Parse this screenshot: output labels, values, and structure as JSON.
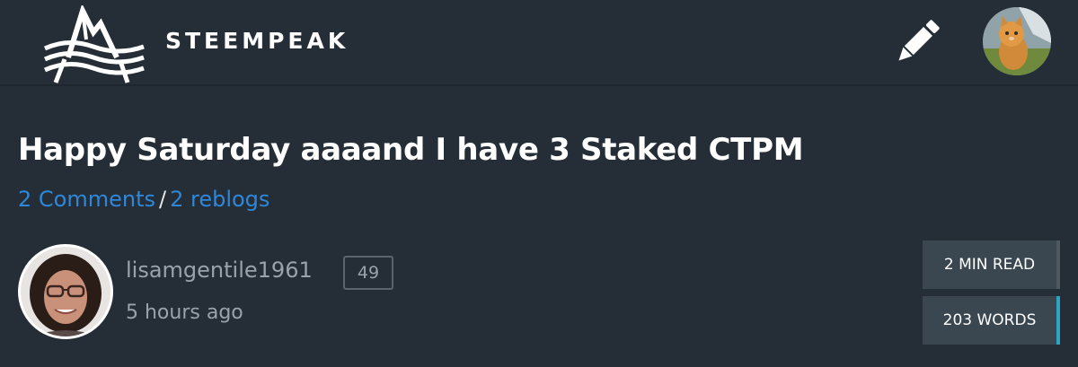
{
  "header": {
    "brand": "STEEMPEAK",
    "logo_icon": "steempeak-mountain-logo-icon",
    "write_icon": "pencil-icon",
    "user_avatar_icon": "user-avatar-kitten"
  },
  "post": {
    "title": "Happy Saturday aaaand I have 3 Staked CTPM",
    "comments_label": "2 Comments",
    "separator": "/",
    "reblogs_label": "2 reblogs"
  },
  "author": {
    "name": "lisamgentile1961",
    "reputation": "49",
    "time": "5 hours ago",
    "avatar_icon": "author-avatar-photo"
  },
  "stats": {
    "read_time": "2 MIN READ",
    "word_count": "203 WORDS"
  },
  "colors": {
    "background": "#252e36",
    "link": "#2f87d9",
    "muted_text": "#9ba3aa",
    "stat_box": "#3a4750",
    "stat_accent": "#2fa3c4"
  }
}
